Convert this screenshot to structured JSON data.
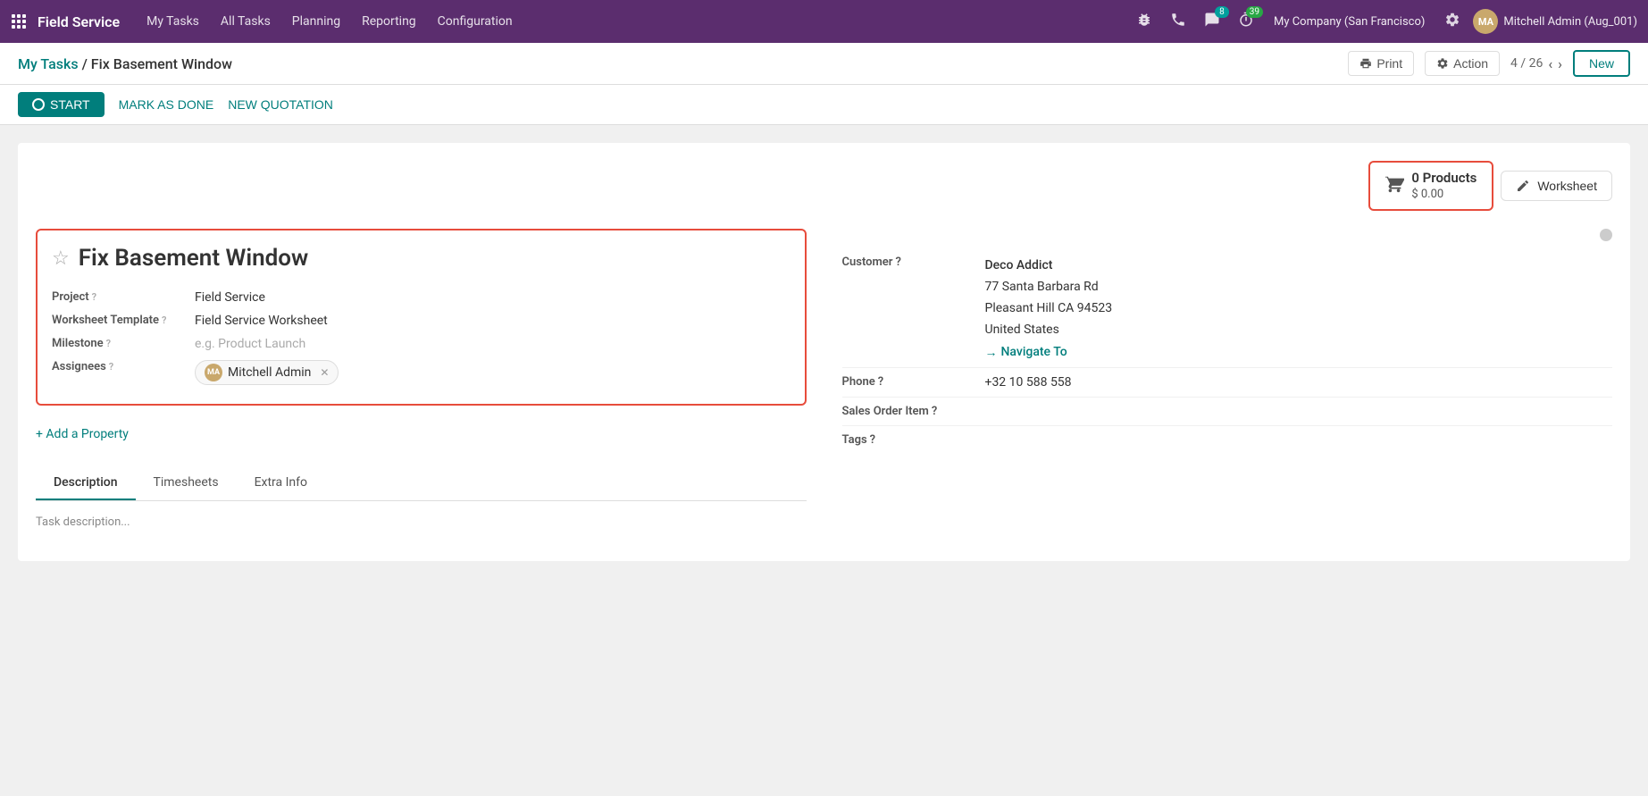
{
  "app": {
    "name": "Field Service",
    "nav_items": [
      "My Tasks",
      "All Tasks",
      "Planning",
      "Reporting",
      "Configuration"
    ]
  },
  "topbar": {
    "bug_icon": "🐞",
    "phone_icon": "📞",
    "chat_badge": "8",
    "timer_badge": "39",
    "company": "My Company (San Francisco)",
    "user_name": "Mitchell Admin (Aug_001)",
    "user_initials": "MA"
  },
  "breadcrumb": {
    "parent": "My Tasks",
    "separator": "/",
    "current": "Fix Basement Window"
  },
  "toolbar": {
    "print_label": "Print",
    "action_label": "Action",
    "pagination": "4 / 26",
    "new_label": "New"
  },
  "actions": {
    "start_label": "START",
    "mark_done_label": "MARK AS DONE",
    "new_quotation_label": "NEW QUOTATION"
  },
  "products_widget": {
    "count": "0 Products",
    "price": "$ 0.00"
  },
  "worksheet_label": "Worksheet",
  "form": {
    "task_title": "Fix Basement Window",
    "project_label": "Project",
    "project_help": "?",
    "project_value": "Field Service",
    "worksheet_template_label": "Worksheet Template",
    "worksheet_template_help": "?",
    "worksheet_template_value": "Field Service Worksheet",
    "milestone_label": "Milestone",
    "milestone_help": "?",
    "milestone_placeholder": "e.g. Product Launch",
    "assignees_label": "Assignees",
    "assignees_help": "?",
    "assignee_name": "Mitchell Admin"
  },
  "customer_section": {
    "customer_label": "Customer",
    "customer_help": "?",
    "customer_name": "Deco Addict",
    "customer_address_line1": "77 Santa Barbara Rd",
    "customer_address_line2": "Pleasant Hill CA 94523",
    "customer_address_line3": "United States",
    "navigate_to": "Navigate To",
    "phone_label": "Phone",
    "phone_help": "?",
    "phone_value": "+32 10 588 558",
    "sales_order_label": "Sales Order Item",
    "sales_order_help": "?",
    "tags_label": "Tags",
    "tags_help": "?"
  },
  "add_property_label": "+ Add a Property",
  "tabs": [
    "Description",
    "Timesheets",
    "Extra Info"
  ],
  "active_tab": "Description",
  "tab_content_hint": "Task description..."
}
